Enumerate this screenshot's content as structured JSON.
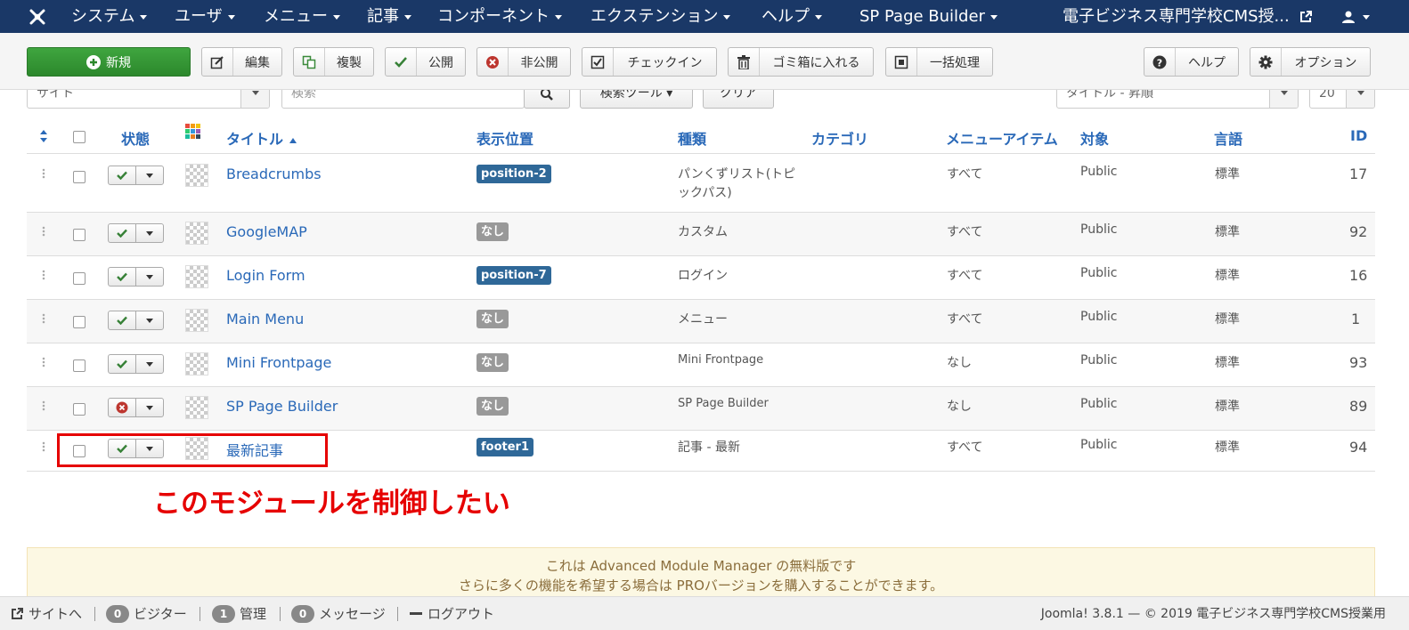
{
  "navbar": {
    "menus": [
      "システム",
      "ユーザ",
      "メニュー",
      "記事",
      "コンポーネント",
      "エクステンション",
      "ヘルプ",
      "SP Page Builder"
    ],
    "site_name": "電子ビジネス専門学校CMS授...",
    "bg_color": "#1a3867"
  },
  "toolbar": {
    "new_label": "新規",
    "edit_label": "編集",
    "copy_label": "複製",
    "publish_label": "公開",
    "unpublish_label": "非公開",
    "checkin_label": "チェックイン",
    "trash_label": "ゴミ箱に入れる",
    "batch_label": "一括処理",
    "help_label": "ヘルプ",
    "options_label": "オプション"
  },
  "filters": {
    "client": "サイト",
    "search_placeholder": "検索",
    "search_tools": "検索ツール",
    "clear": "クリア",
    "ordering": "タイトル - 昇順",
    "limit": "20"
  },
  "table": {
    "headers": {
      "status": "状態",
      "title": "タイトル",
      "position": "表示位置",
      "type": "種類",
      "category": "カテゴリ",
      "menu_item": "メニューアイテム",
      "access": "対象",
      "language": "言語",
      "id": "ID"
    },
    "rows": [
      {
        "title": "Breadcrumbs",
        "position": "position-2",
        "type_line1": "パンくずリスト(トピ",
        "type_line2": "ックパス)",
        "menu": "すべて",
        "access": "Public",
        "language": "標準",
        "id": "17"
      },
      {
        "title": "GoogleMAP",
        "position": "なし",
        "type": "カスタム",
        "menu": "すべて",
        "access": "Public",
        "language": "標準",
        "id": "92"
      },
      {
        "title": "Login Form",
        "position": "position-7",
        "type": "ログイン",
        "menu": "すべて",
        "access": "Public",
        "language": "標準",
        "id": "16"
      },
      {
        "title": "Main Menu",
        "position": "なし",
        "type": "メニュー",
        "menu": "すべて",
        "access": "Public",
        "language": "標準",
        "id": "1"
      },
      {
        "title": "Mini Frontpage",
        "position": "なし",
        "type": "Mini Frontpage",
        "menu": "なし",
        "access": "Public",
        "language": "標準",
        "id": "93"
      },
      {
        "title": "SP Page Builder",
        "position": "なし",
        "type": "SP Page Builder",
        "menu": "なし",
        "access": "Public",
        "language": "標準",
        "id": "89"
      },
      {
        "title": "最新記事",
        "position": "footer1",
        "type": "記事 - 最新",
        "menu": "すべて",
        "access": "Public",
        "language": "標準",
        "id": "94"
      }
    ]
  },
  "annotation": {
    "text": "このモジュールを制御したい",
    "color": "#e60000"
  },
  "notice": {
    "line1": "これは Advanced Module Manager の無料版です",
    "line2": "さらに多くの機能を希望する場合は PROバージョンを購入することができます。"
  },
  "statusbar": {
    "site": "サイトへ",
    "visitors_count": "0",
    "visitors_label": "ビジター",
    "admins_count": "1",
    "admins_label": "管理",
    "messages_count": "0",
    "messages_label": "メッセージ",
    "logout": "ログアウト",
    "copyright": "Joomla! 3.8.1 — © 2019 電子ビジネス専門学校CMS授業用"
  }
}
